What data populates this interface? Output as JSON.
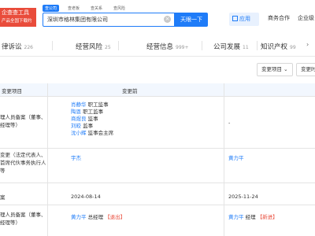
{
  "header": {
    "logo_line1": "企查查工具",
    "logo_line2": "产品全国下载约",
    "search_tabs": [
      "查公司",
      "查老板",
      "查关系",
      "查风险"
    ],
    "search_value": "深圳市格林集团有限公司",
    "search_button": "天眼一下",
    "app_button": "应用",
    "links": [
      "商务合作",
      "企业级"
    ]
  },
  "tabs": [
    {
      "label": "律诉讼",
      "count": "226"
    },
    {
      "label": "经营风险",
      "count": "25"
    },
    {
      "label": "经营信息",
      "count": "999+"
    },
    {
      "label": "公司发展",
      "count": "11"
    },
    {
      "label": "知识产权",
      "count": "99"
    }
  ],
  "filters": {
    "change_item": "变更项目",
    "change_time": "变更时"
  },
  "table": {
    "headers": {
      "item": "变更项目",
      "before": "变更前"
    },
    "rows": [
      {
        "item": "理人员备案（董事、经理等）",
        "before": [
          {
            "name": "肖静华",
            "role": "职工监事"
          },
          {
            "name": "陶恩",
            "role": "职工监事"
          },
          {
            "name": "商煜良",
            "role": "监事"
          },
          {
            "name": "刘皎",
            "role": "监事"
          },
          {
            "name": "沈小辉",
            "role": "监事会主席"
          }
        ],
        "after": "-"
      },
      {
        "item": "变更（法定代表人、首席代伙事务执行人等",
        "before_name": "宇杰",
        "after_name": "黄力平"
      },
      {
        "item": "案",
        "before_date": "2024-08-14",
        "after_date": "2025-11-24"
      },
      {
        "item": "理人员备案（董事、经理等）",
        "before": {
          "name": "黄力平",
          "role": "总经理",
          "tag": "【退出】"
        },
        "after": {
          "name": "黄力平",
          "role": "经理",
          "tag": "【新进】"
        }
      }
    ]
  }
}
